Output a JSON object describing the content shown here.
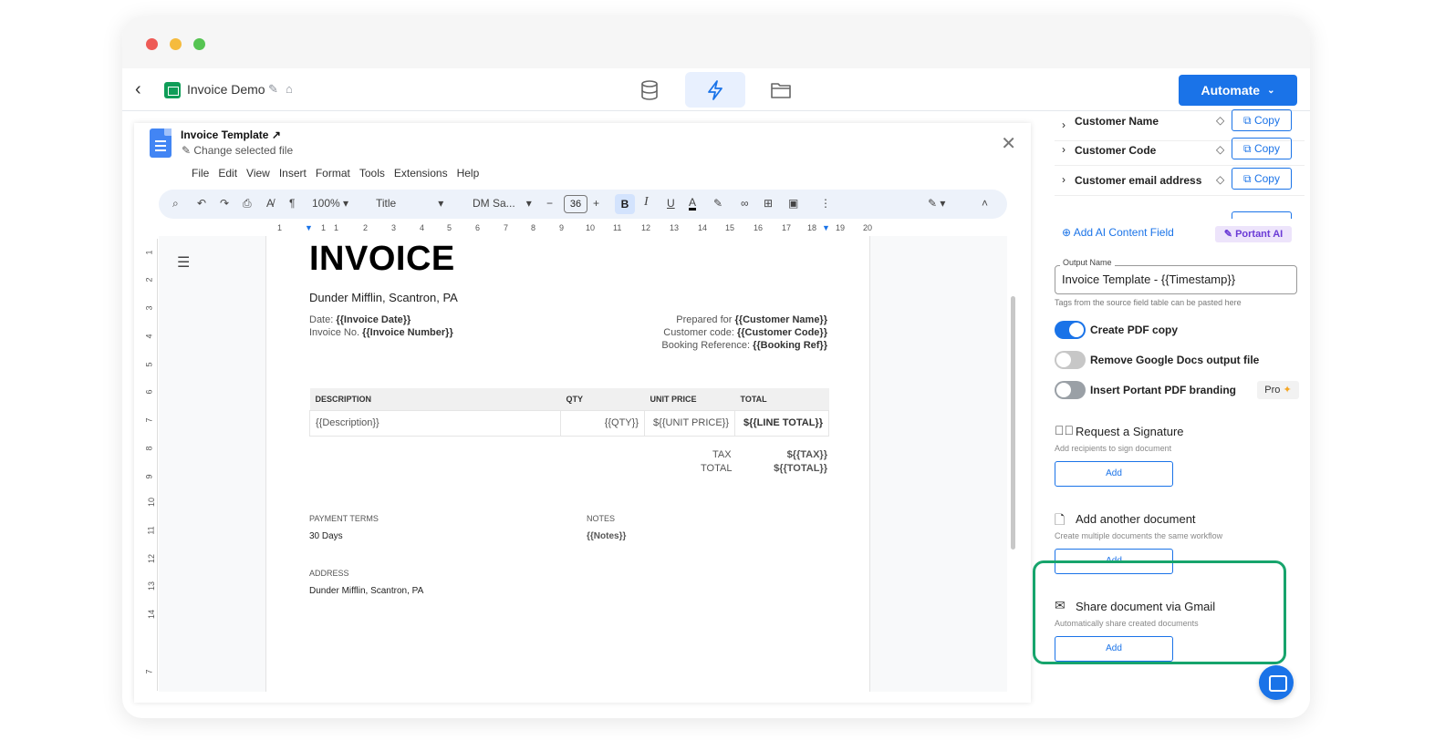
{
  "app": {
    "title": "Invoice Demo",
    "automate_label": "Automate",
    "nav_icons": [
      "database-icon",
      "lightning-icon",
      "folder-icon"
    ]
  },
  "doc": {
    "template_name": "Invoice Template",
    "change_file": "Change selected file",
    "menu": [
      "File",
      "Edit",
      "View",
      "Insert",
      "Format",
      "Tools",
      "Extensions",
      "Help"
    ],
    "toolbar": {
      "zoom": "100%",
      "style": "Title",
      "font": "DM Sa...",
      "font_size": "36",
      "bold": "B",
      "italic": "I",
      "underline": "U",
      "text_color": "A"
    },
    "ruler_h": [
      "1",
      "1",
      "1",
      "2",
      "3",
      "4",
      "5",
      "6",
      "7",
      "8",
      "9",
      "10",
      "11",
      "12",
      "13",
      "14",
      "15",
      "16",
      "17",
      "18",
      "19",
      "20"
    ],
    "ruler_v": [
      "1",
      "2",
      "3",
      "4",
      "5",
      "6",
      "7",
      "8",
      "9",
      "10",
      "11",
      "12",
      "13",
      "14",
      "7"
    ]
  },
  "invoice": {
    "title": "INVOICE",
    "company": "Dunder Mifflin, Scantron, PA",
    "date_label": "Date:",
    "date_value": "{{Invoice Date}}",
    "no_label": "Invoice No.",
    "no_value": "{{Invoice Number}}",
    "prepared_label": "Prepared for",
    "prepared_value": "{{Customer Name}}",
    "code_label": "Customer code:",
    "code_value": "{{Customer Code}}",
    "booking_label": "Booking Reference:",
    "booking_value": "{{Booking Ref}}",
    "table_headers": [
      "DESCRIPTION",
      "QTY",
      "UNIT PRICE",
      "TOTAL"
    ],
    "table_row": [
      "{{Description}}",
      "{{QTY}}",
      "${{UNIT PRICE}}",
      "${{LINE TOTAL}}"
    ],
    "tax_label": "TAX",
    "tax_value": "${{TAX}}",
    "total_label": "TOTAL",
    "total_value": "${{TOTAL}}",
    "payment_label": "PAYMENT TERMS",
    "payment_value": "30 Days",
    "notes_label": "NOTES",
    "notes_value": "{{Notes}}",
    "address_label": "ADDRESS",
    "address_value": "Dunder Mifflin, Scantron, PA"
  },
  "panel": {
    "fields": [
      {
        "name": "Customer Name",
        "copy": "Copy"
      },
      {
        "name": "Customer Code",
        "copy": "Copy"
      },
      {
        "name": "Customer email address",
        "copy": "Copy"
      }
    ],
    "add_ai": "Add AI Content Field",
    "portant_ai": "Portant AI",
    "output_label": "Output Name",
    "output_value": "Invoice Template - {{Timestamp}}",
    "output_hint": "Tags from the source field table can be pasted here",
    "toggles": [
      {
        "label": "Create PDF copy",
        "on": true
      },
      {
        "label": "Remove Google Docs output file",
        "on": false
      },
      {
        "label": "Insert Portant PDF branding",
        "on": false
      }
    ],
    "pro": "Pro",
    "signature": {
      "title": "Request a Signature",
      "desc": "Add recipients to sign document",
      "button": "Add"
    },
    "another": {
      "title": "Add another document",
      "desc": "Create multiple documents the same workflow",
      "button": "Add"
    },
    "gmail": {
      "title": "Share document via Gmail",
      "desc": "Automatically share created documents",
      "button": "Add"
    }
  },
  "colors": {
    "accent": "#1a73e8",
    "highlight": "#17a46c",
    "sheet_green": "#0f9d58"
  }
}
